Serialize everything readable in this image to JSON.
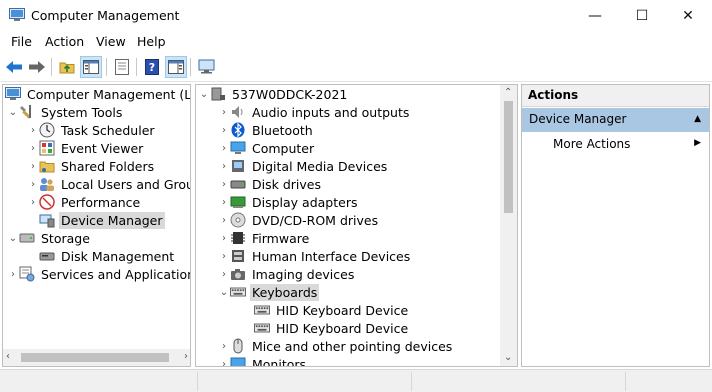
{
  "window": {
    "title": "Computer Management",
    "icon": "computer-management-icon",
    "controls": {
      "minimize": "—",
      "maximize": "☐",
      "close": "✕"
    }
  },
  "menu": [
    "File",
    "Action",
    "View",
    "Help"
  ],
  "toolbar": {
    "icons": [
      "back-icon",
      "forward-icon",
      "up-folder-icon",
      "show-hide-tree-icon",
      "properties-icon",
      "help-icon",
      "show-hide-action-pane-icon",
      "scan-hardware-icon"
    ]
  },
  "left_tree": {
    "root": "Computer Management (Local",
    "system_tools": "System Tools",
    "items": [
      "Task Scheduler",
      "Event Viewer",
      "Shared Folders",
      "Local Users and Groups",
      "Performance",
      "Device Manager"
    ],
    "storage": "Storage",
    "storage_items": [
      "Disk Management"
    ],
    "services": "Services and Applications",
    "selected": "Device Manager"
  },
  "device_tree": {
    "computer_name": "537W0DDCK-2021",
    "categories": [
      "Audio inputs and outputs",
      "Bluetooth",
      "Computer",
      "Digital Media Devices",
      "Disk drives",
      "Display adapters",
      "DVD/CD-ROM drives",
      "Firmware",
      "Human Interface Devices",
      "Imaging devices",
      "Keyboards"
    ],
    "keyboards_children": [
      "HID Keyboard Device",
      "HID Keyboard Device"
    ],
    "after": [
      "Mice and other pointing devices",
      "Monitors"
    ],
    "expanded": "Keyboards"
  },
  "actions": {
    "header": "Actions",
    "section": "Device Manager",
    "items": [
      "More Actions"
    ]
  },
  "colors": {
    "selection_bg": "#d9d9d9",
    "action_section_bg": "#a9c6e3",
    "accent": "#0078d7"
  }
}
